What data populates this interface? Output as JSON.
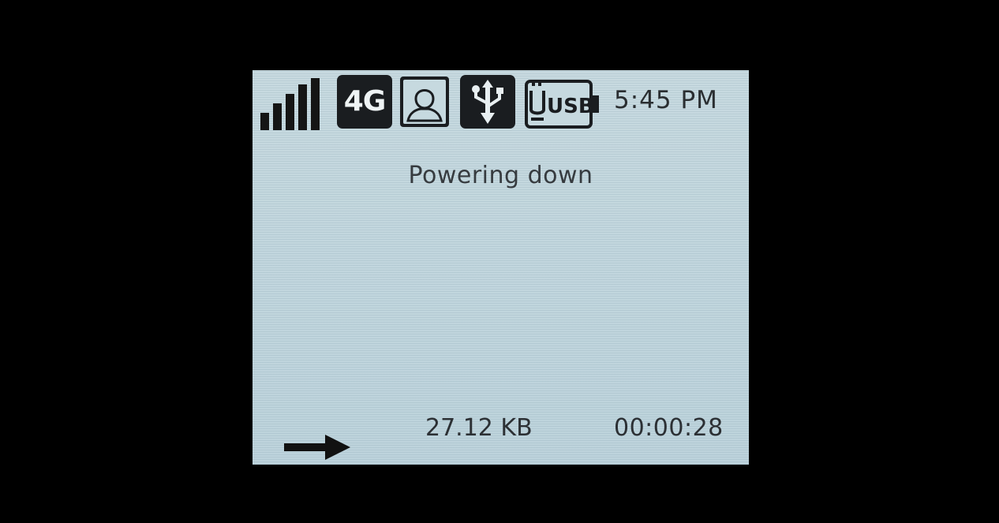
{
  "status_bar": {
    "signal_strength": "5 of 5 bars",
    "network_badge": "4G",
    "icons": [
      "signal-strength-icon",
      "profile-user-icon",
      "usb-tether-icon",
      "usb-battery-icon"
    ],
    "usb_label": "USB",
    "clock": "5:45 PM"
  },
  "main": {
    "message": "Powering down"
  },
  "footer": {
    "direction_icon": "arrow-right-icon",
    "data_usage": "27.12 KB",
    "duration": "00:00:28"
  },
  "colors": {
    "lcd_background": "#c3d7de",
    "foreground": "#1a1d20",
    "frame": "#000000"
  }
}
